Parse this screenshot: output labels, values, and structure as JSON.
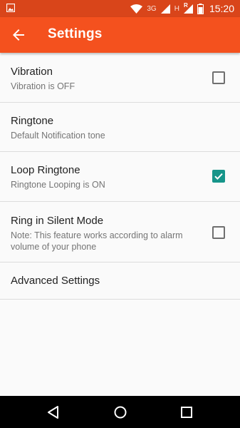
{
  "status_bar": {
    "network_type": "3G",
    "roaming_indicator": "H",
    "roaming_r": "R",
    "time": "15:20",
    "icons": [
      "image-icon",
      "wifi-icon",
      "signal-icon",
      "signal-roaming-icon",
      "battery-icon"
    ]
  },
  "app_bar": {
    "title": "Settings",
    "back_icon": "arrow-back-icon"
  },
  "settings": [
    {
      "title": "Vibration",
      "subtitle": "Vibration is OFF",
      "checked": false
    },
    {
      "title": "Ringtone",
      "subtitle": "Default Notification tone"
    },
    {
      "title": "Loop Ringtone",
      "subtitle": "Ringtone Looping is ON",
      "checked": true
    },
    {
      "title": "Ring in Silent Mode",
      "subtitle": "Note: This feature works according to alarm volume of your phone",
      "checked": false
    },
    {
      "title": "Advanced Settings"
    }
  ],
  "nav_bar": {
    "icons": [
      "back-triangle-icon",
      "home-circle-icon",
      "recents-square-icon"
    ]
  },
  "colors": {
    "status_bar": "#d9451a",
    "app_bar": "#f4511e",
    "accent": "#16958a"
  }
}
